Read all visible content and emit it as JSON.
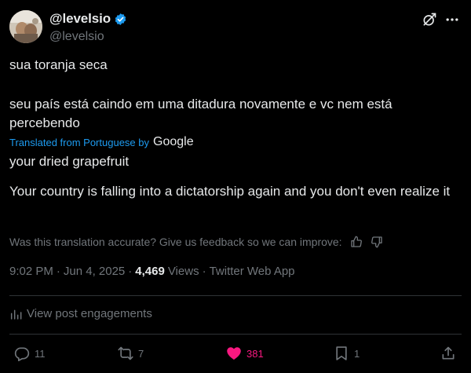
{
  "author": {
    "display_name": "@levelsio",
    "handle": "@levelsio"
  },
  "post": {
    "original_line1": "sua toranja seca",
    "original_line2": "seu país está caindo em uma ditadura novamente e vc nem está percebendo",
    "translated_from": "Translated from Portuguese by",
    "translator": "Google",
    "translated_line1": "your dried grapefruit",
    "translated_line2": "Your country is falling into a dictatorship again and you don't even realize it"
  },
  "feedback": {
    "prompt": "Was this translation accurate? Give us feedback so we can improve:"
  },
  "meta": {
    "time": "9:02 PM",
    "date": "Jun 4, 2025",
    "views_count": "4,469",
    "views_label": "Views",
    "source": "Twitter Web App",
    "separator": "·"
  },
  "engagements_label": "View post engagements",
  "actions": {
    "replies": "11",
    "reposts": "7",
    "likes": "381",
    "bookmarks": "1"
  },
  "icons": {
    "verified": "verified-badge-icon",
    "grok": "grok-icon",
    "more": "more-icon",
    "thumbs_up": "thumbs-up-icon",
    "thumbs_down": "thumbs-down-icon",
    "analytics": "analytics-icon",
    "reply": "reply-icon",
    "repost": "repost-icon",
    "like": "heart-icon",
    "bookmark": "bookmark-icon",
    "share": "share-icon"
  },
  "colors": {
    "background": "#000000",
    "text": "#e7e9ea",
    "muted": "#71767b",
    "accent": "#1d9bf0",
    "like": "#f91880",
    "divider": "#2f3336"
  }
}
